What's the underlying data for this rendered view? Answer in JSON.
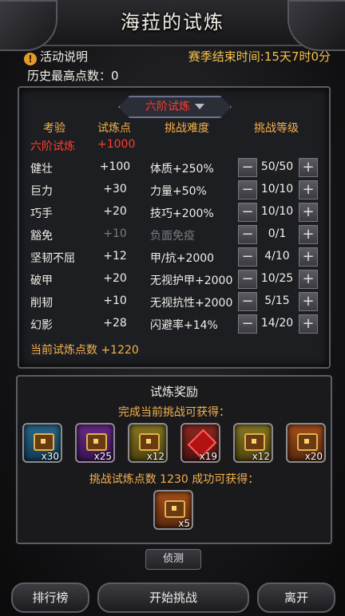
{
  "header": {
    "title": "海菈的试炼"
  },
  "info": {
    "notice_icon": "!",
    "activity_label": "活动说明",
    "season_label": "赛季结束时间:15天7时0分",
    "best_score_label": "历史最高点数：0"
  },
  "tier": {
    "selected": "六阶试炼",
    "caret_icon": "chevron-down-icon"
  },
  "columns": {
    "trial": "考验",
    "points": "试炼点",
    "difficulty": "挑战难度",
    "level": "挑战等级"
  },
  "summary_row": {
    "trial": "六阶试炼",
    "points": "+1000"
  },
  "trials": [
    {
      "name": "健壮",
      "points": "+100",
      "effect": "体质+250%",
      "level": "50/50"
    },
    {
      "name": "巨力",
      "points": "+30",
      "effect": "力量+50%",
      "level": "10/10"
    },
    {
      "name": "巧手",
      "points": "+20",
      "effect": "技巧+200%",
      "level": "10/10"
    },
    {
      "name": "豁免",
      "points": "+10",
      "effect": "负面免疫",
      "level": "0/1"
    },
    {
      "name": "坚韧不屈",
      "points": "+12",
      "effect": "甲/抗+2000",
      "level": "4/10"
    },
    {
      "name": "破甲",
      "points": "+20",
      "effect": "无视护甲+2000",
      "level": "10/25"
    },
    {
      "name": "削韧",
      "points": "+10",
      "effect": "无视抗性+2000",
      "level": "5/15"
    },
    {
      "name": "幻影",
      "points": "+28",
      "effect": "闪避率+14%",
      "level": "14/20"
    }
  ],
  "stepper": {
    "minus": "−",
    "plus": "+"
  },
  "total": "当前试炼点数 +1220",
  "rewards": {
    "title": "试炼奖励",
    "current_label": "完成当前挑战可获得：",
    "items": [
      {
        "qty": "x30",
        "quality": "blue",
        "icon": "chest-icon"
      },
      {
        "qty": "x25",
        "quality": "purple",
        "icon": "chest-icon"
      },
      {
        "qty": "x12",
        "quality": "yellow",
        "icon": "chest-icon"
      },
      {
        "qty": "x19",
        "quality": "red",
        "icon": "gem-icon"
      },
      {
        "qty": "x12",
        "quality": "yellow",
        "icon": "chest-icon"
      },
      {
        "qty": "x20",
        "quality": "orange",
        "icon": "chest-icon"
      }
    ],
    "challenge_label": "挑战试炼点数 1230 成功可获得：",
    "challenge_item": {
      "qty": "x5",
      "quality": "orange",
      "icon": "chest-icon"
    }
  },
  "spy_button": "侦测",
  "buttons": {
    "ranking": "排行榜",
    "start": "开始挑战",
    "leave": "离开"
  },
  "colors": {
    "accent_gold": "#f5b04a",
    "red": "#ff3b30",
    "season": "#f5c14a"
  }
}
